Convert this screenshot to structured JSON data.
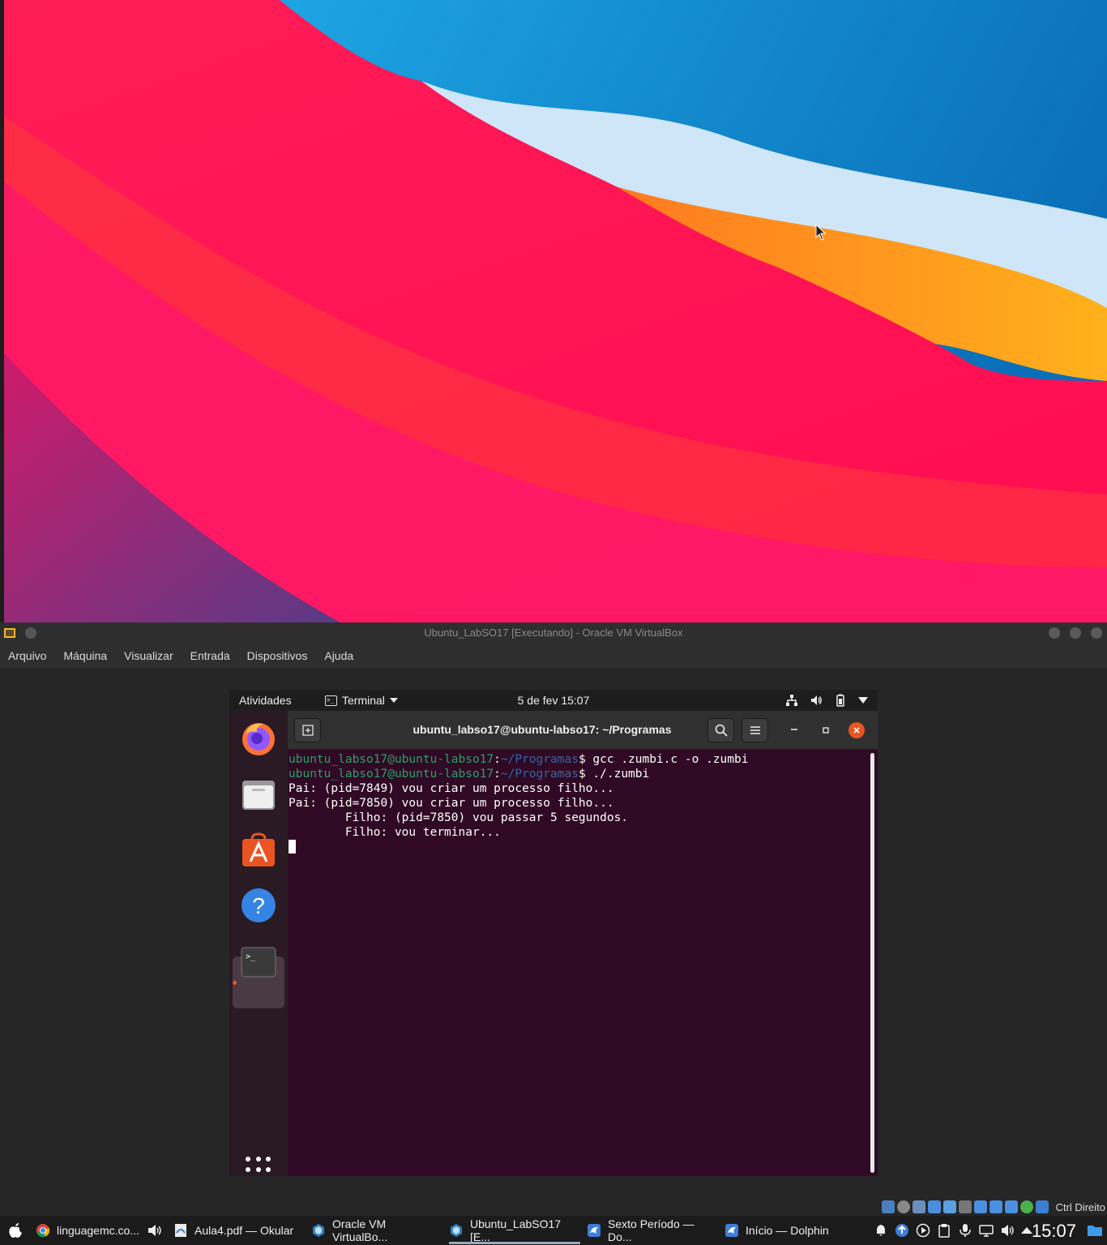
{
  "vbox": {
    "title": "Ubuntu_LabSO17 [Executando] - Oracle VM VirtualBox",
    "menu": [
      "Arquivo",
      "Máquina",
      "Visualizar",
      "Entrada",
      "Dispositivos",
      "Ajuda"
    ],
    "host_key_label": "Ctrl Direito"
  },
  "guest": {
    "activities": "Atividades",
    "app_menu": "Terminal",
    "clock": "5 de fev  15:07",
    "dock_apps": [
      "firefox-icon",
      "files-icon",
      "ubuntu-software-icon",
      "help-icon",
      "terminal-icon"
    ],
    "terminal": {
      "title": "ubuntu_labso17@ubuntu-labso17: ~/Programas",
      "lines": [
        {
          "user": "ubuntu_labso17@ubuntu-labso17",
          "sep": ":",
          "path": "~/Programas",
          "cmd": "$ gcc .zumbi.c -o .zumbi"
        },
        {
          "user": "ubuntu_labso17@ubuntu-labso17",
          "sep": ":",
          "path": "~/Programas",
          "cmd": "$ ./.zumbi"
        }
      ],
      "output": [
        "Pai: (pid=7849) vou criar um processo filho...",
        "Pai: (pid=7850) vou criar um processo filho...",
        "        Filho: (pid=7850) vou passar 5 segundos.",
        "        Filho: vou terminar..."
      ]
    }
  },
  "taskbar": {
    "tasks": [
      {
        "label": "linguagemc.co...",
        "icon": "chrome-icon"
      },
      {
        "label": "Aula4.pdf  — Okular",
        "icon": "okular-icon"
      },
      {
        "label": "Oracle VM VirtualBo...",
        "icon": "virtualbox-icon"
      },
      {
        "label": "Ubuntu_LabSO17 [E...",
        "icon": "virtualbox-icon"
      },
      {
        "label": "Sexto Período — Do...",
        "icon": "dolphin-icon"
      },
      {
        "label": "Início — Dolphin",
        "icon": "dolphin-icon"
      }
    ],
    "clock": "15:07"
  }
}
